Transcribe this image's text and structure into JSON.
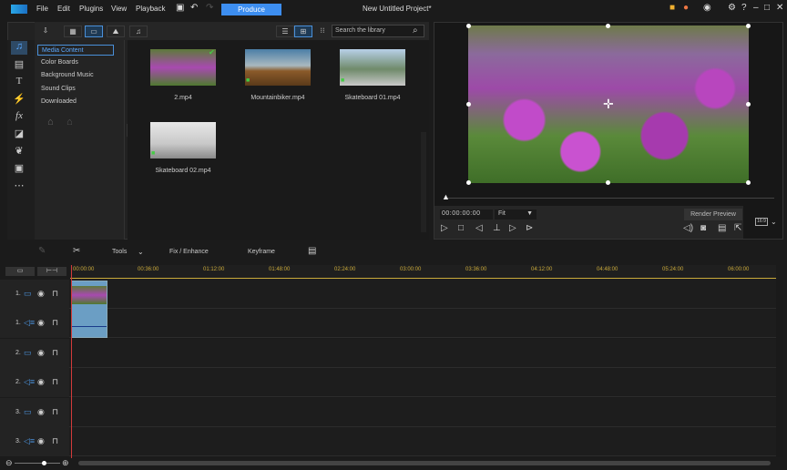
{
  "menu": {
    "items": [
      "File",
      "Edit",
      "Plugins",
      "View",
      "Playback"
    ],
    "produce": "Produce",
    "project_title": "New Untitled Project*"
  },
  "library": {
    "search_placeholder": "Search the library",
    "categories": [
      "Media Content",
      "Color Boards",
      "Background Music",
      "Sound Clips",
      "Downloaded"
    ],
    "media": [
      {
        "name": "2.mp4"
      },
      {
        "name": "Mountainbiker.mp4"
      },
      {
        "name": "Skateboard 01.mp4"
      },
      {
        "name": "Skateboard 02.mp4"
      }
    ]
  },
  "preview": {
    "timecode": "00:00:00:00",
    "fit": "Fit",
    "render_preview": "Render Preview",
    "aspect": "16:9"
  },
  "timeline": {
    "tools": "Tools",
    "fix_enhance": "Fix / Enhance",
    "keyframe": "Keyframe",
    "ruler": [
      "00:00:00",
      "00:36:00",
      "01:12:00",
      "01:48:00",
      "02:24:00",
      "03:00:00",
      "03:36:00",
      "04:12:00",
      "04:48:00",
      "05:24:00",
      "06:00:00"
    ],
    "tracks": [
      "1.",
      "1.",
      "2.",
      "2.",
      "3.",
      "3."
    ]
  },
  "colors": {
    "accent": "#3d8ef0",
    "ruler_text": "#c9a93a",
    "playhead": "#d23a3a"
  }
}
